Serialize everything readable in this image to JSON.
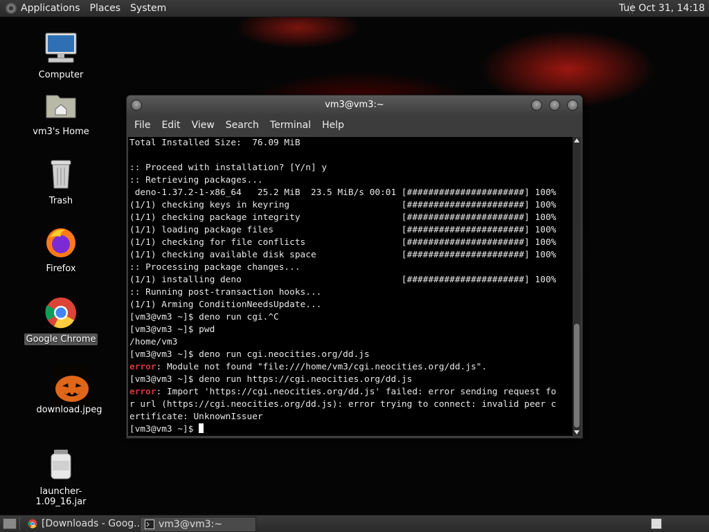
{
  "top_panel": {
    "menus": [
      "Applications",
      "Places",
      "System"
    ],
    "clock": "Tue Oct 31, 14:18"
  },
  "desktop_icons": [
    {
      "label": "Computer",
      "icon": "computer-icon"
    },
    {
      "label": "vm3's Home",
      "icon": "home-folder-icon"
    },
    {
      "label": "Trash",
      "icon": "trash-icon"
    },
    {
      "label": "Firefox",
      "icon": "firefox-icon"
    },
    {
      "label": "Google Chrome",
      "icon": "chrome-icon"
    },
    {
      "label": "download.jpeg",
      "icon": "image-file-icon"
    },
    {
      "label": "launcher-1.09_16.jar",
      "icon": "jar-file-icon"
    }
  ],
  "terminal": {
    "title": "vm3@vm3:~",
    "menus": [
      "File",
      "Edit",
      "View",
      "Search",
      "Terminal",
      "Help"
    ],
    "lines": [
      {
        "text": "Total Installed Size:  76.09 MiB"
      },
      {
        "text": ""
      },
      {
        "text": ":: Proceed with installation? [Y/n] y"
      },
      {
        "text": ":: Retrieving packages..."
      },
      {
        "text": " deno-1.37.2-1-x86_64   25.2 MiB  23.5 MiB/s 00:01 [######################] 100%"
      },
      {
        "text": "(1/1) checking keys in keyring                     [######################] 100%"
      },
      {
        "text": "(1/1) checking package integrity                   [######################] 100%"
      },
      {
        "text": "(1/1) loading package files                        [######################] 100%"
      },
      {
        "text": "(1/1) checking for file conflicts                  [######################] 100%"
      },
      {
        "text": "(1/1) checking available disk space                [######################] 100%"
      },
      {
        "text": ":: Processing package changes..."
      },
      {
        "text": "(1/1) installing deno                              [######################] 100%"
      },
      {
        "text": ":: Running post-transaction hooks..."
      },
      {
        "text": "(1/1) Arming ConditionNeedsUpdate..."
      },
      {
        "text": "[vm3@vm3 ~]$ deno run cgi.^C"
      },
      {
        "text": "[vm3@vm3 ~]$ pwd"
      },
      {
        "text": "/home/vm3"
      },
      {
        "text": "[vm3@vm3 ~]$ deno run cgi.neocities.org/dd.js"
      },
      {
        "err": "error",
        "text": ": Module not found \"file:///home/vm3/cgi.neocities.org/dd.js\"."
      },
      {
        "text": "[vm3@vm3 ~]$ deno run https://cgi.neocities.org/dd.js"
      },
      {
        "err": "error",
        "text": ": Import 'https://cgi.neocities.org/dd.js' failed: error sending request fo"
      },
      {
        "text": "r url (https://cgi.neocities.org/dd.js): error trying to connect: invalid peer c"
      },
      {
        "text": "ertificate: UnknownIssuer"
      },
      {
        "text": "[vm3@vm3 ~]$ ",
        "cursor": true
      }
    ]
  },
  "taskbar": {
    "tasks": [
      {
        "label": "[Downloads - Goog...",
        "icon": "chrome-icon"
      },
      {
        "label": "vm3@vm3:~",
        "icon": "terminal-icon"
      }
    ]
  },
  "colors": {
    "error": "#d23a3a",
    "terminal_bg": "#000000"
  }
}
